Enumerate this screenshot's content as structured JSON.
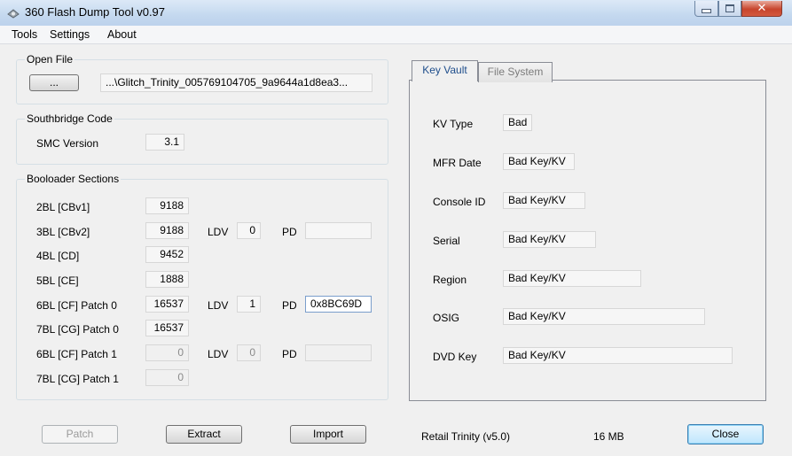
{
  "window": {
    "title": "360 Flash Dump Tool  v0.97"
  },
  "menu": {
    "items": [
      "Tools",
      "Settings",
      "About"
    ]
  },
  "open_file": {
    "title": "Open File",
    "browse_label": "...",
    "path": "...\\Glitch_Trinity_005769104705_9a9644a1d8ea3..."
  },
  "southbridge": {
    "title": "Southbridge Code",
    "smc_label": "SMC Version",
    "smc_value": "3.1"
  },
  "bootloader": {
    "title": "Booloader Sections",
    "ldv_label": "LDV",
    "pd_label": "PD",
    "rows": [
      {
        "label": "2BL [CBv1]",
        "value": "9188"
      },
      {
        "label": "3BL [CBv2]",
        "value": "9188",
        "ldv": "0",
        "pd": ""
      },
      {
        "label": "4BL [CD]",
        "value": "9452"
      },
      {
        "label": "5BL [CE]",
        "value": "1888"
      },
      {
        "label": "6BL [CF] Patch 0",
        "value": "16537",
        "ldv": "1",
        "pd": "0x8BC69D"
      },
      {
        "label": "7BL [CG] Patch 0",
        "value": "16537"
      },
      {
        "label": "6BL [CF] Patch 1",
        "value": "0",
        "ldv": "0",
        "pd": ""
      },
      {
        "label": "7BL [CG] Patch 1",
        "value": "0"
      }
    ]
  },
  "tabs": {
    "key_vault": "Key Vault",
    "file_system": "File System"
  },
  "key_vault": {
    "fields": [
      {
        "label": "KV Type",
        "value": "Bad"
      },
      {
        "label": "MFR Date",
        "value": "Bad Key/KV"
      },
      {
        "label": "Console ID",
        "value": "Bad Key/KV"
      },
      {
        "label": "Serial",
        "value": "Bad Key/KV"
      },
      {
        "label": "Region",
        "value": "Bad Key/KV"
      },
      {
        "label": "OSIG",
        "value": "Bad Key/KV"
      },
      {
        "label": "DVD Key",
        "value": "Bad Key/KV"
      }
    ]
  },
  "buttons": {
    "patch": "Patch",
    "extract": "Extract",
    "import": "Import",
    "close": "Close"
  },
  "status": {
    "console": "Retail Trinity (v5.0)",
    "size": "16 MB"
  }
}
